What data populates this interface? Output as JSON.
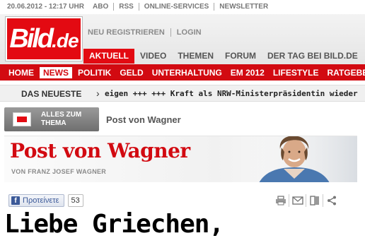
{
  "meta": {
    "datetime": "20.06.2012 - 12:17 UHR",
    "links": [
      "ABO",
      "RSS",
      "ONLINE-SERVICES",
      "NEWSLETTER"
    ]
  },
  "logo": {
    "text_main": "Bild",
    "text_tld": ".de"
  },
  "account": {
    "register": "NEU REGISTRIEREN",
    "login": "LOGIN"
  },
  "sections": [
    {
      "label": "AKTUELL",
      "active": true
    },
    {
      "label": "VIDEO"
    },
    {
      "label": "THEMEN"
    },
    {
      "label": "FORUM"
    },
    {
      "label": "DER TAG BEI BILD.DE"
    }
  ],
  "nav": [
    {
      "label": "HOME"
    },
    {
      "label": "NEWS",
      "active": true
    },
    {
      "label": "POLITIK"
    },
    {
      "label": "GELD"
    },
    {
      "label": "UNTERHALTUNG"
    },
    {
      "label": "EM 2012"
    },
    {
      "label": "LIFESTYLE"
    },
    {
      "label": "RATGEBER"
    }
  ],
  "ticker": {
    "label": "DAS NEUESTE",
    "arrow": "›",
    "text": "eigen +++ +++ Kraft als NRW-Ministerpräsidentin wieder"
  },
  "topic": {
    "all_button": "ALLES ZUM THEMA",
    "name": "Post von Wagner"
  },
  "banner": {
    "title": "Post von Wagner",
    "byline": "VON FRANZ JOSEF WAGNER"
  },
  "social": {
    "fb_label": "Προτείνετε",
    "fb_count": "53",
    "tools": [
      "print-icon",
      "mail-icon",
      "bookmark-icon",
      "share-icon"
    ]
  },
  "article": {
    "headline": "Liebe Griechen,"
  },
  "colors": {
    "brand_red": "#d20a11",
    "logo_red": "#e30a12",
    "facebook": "#3b5998"
  }
}
